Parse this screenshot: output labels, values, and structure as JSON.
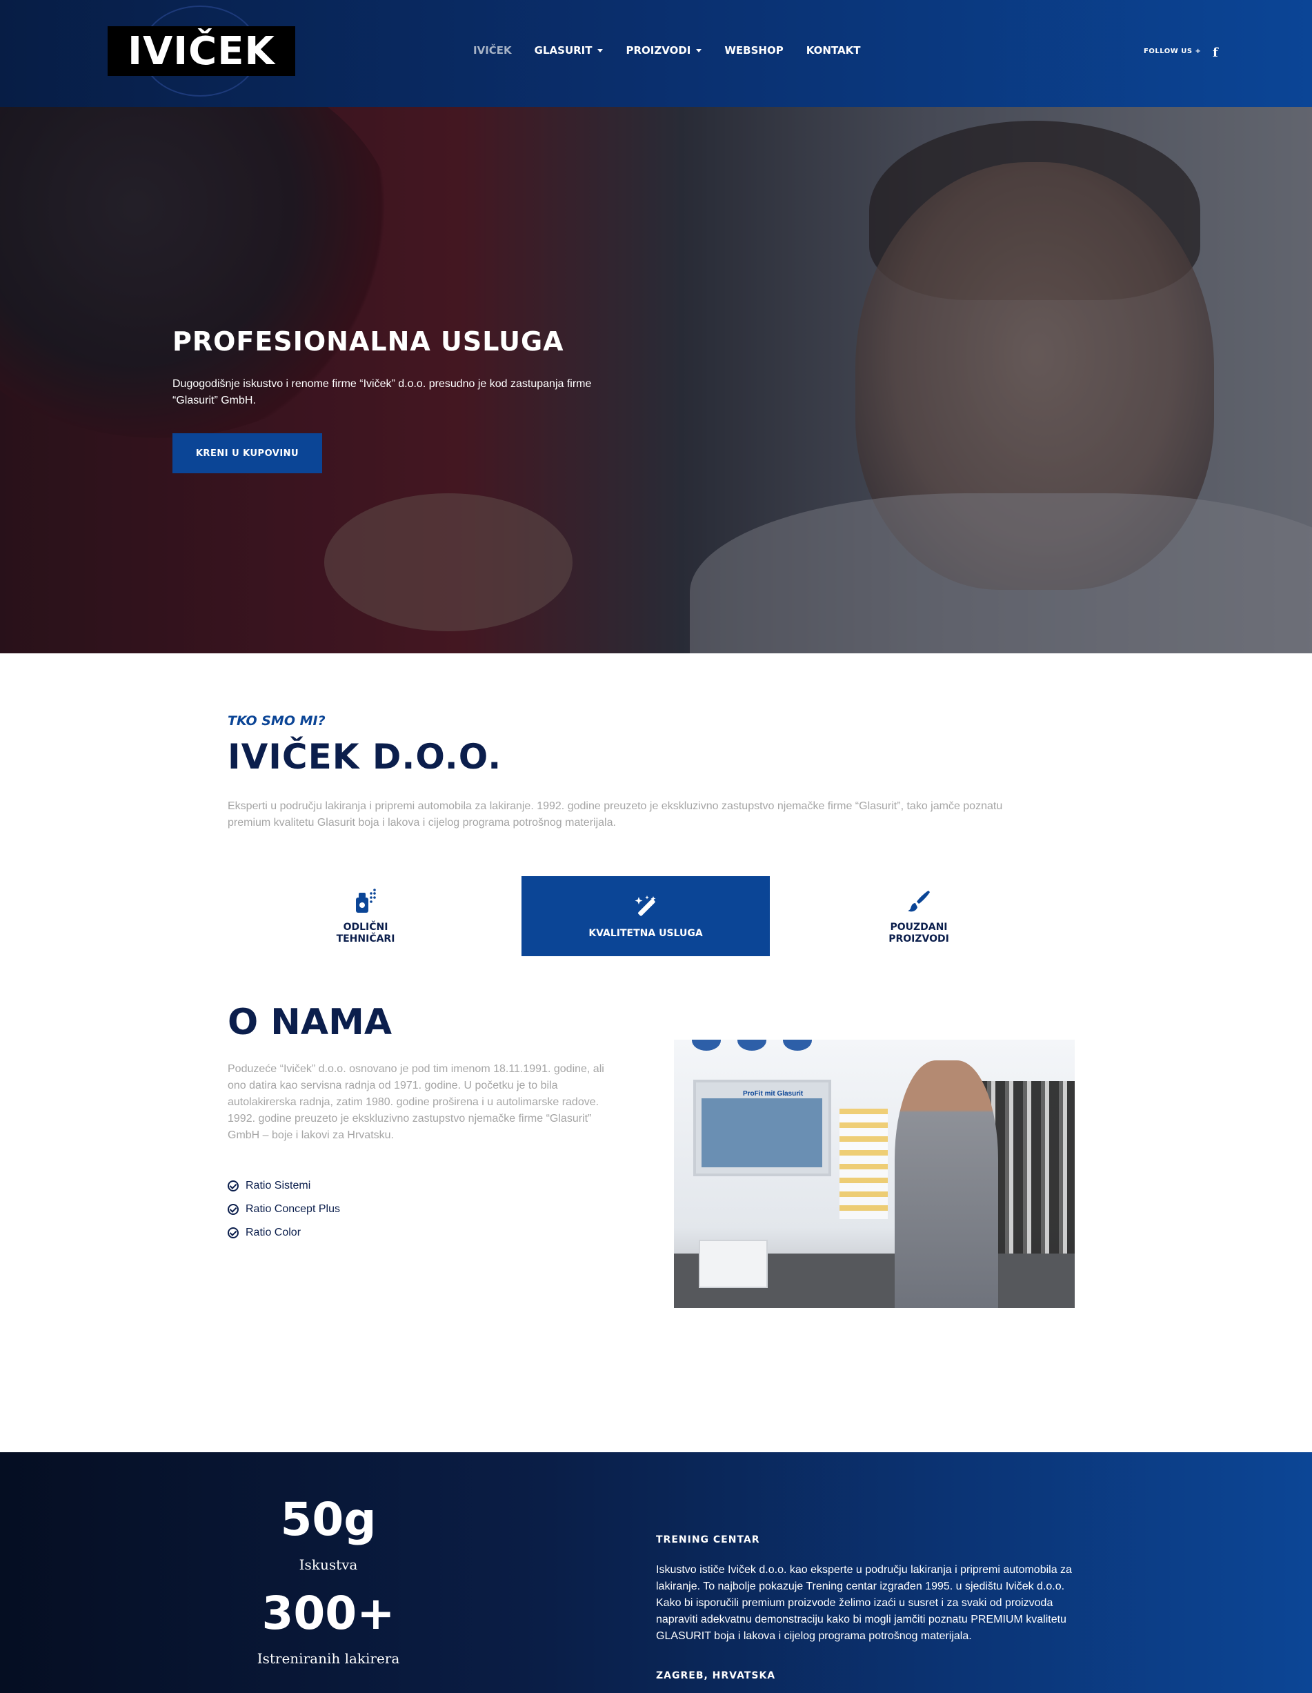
{
  "header": {
    "logo_text": "IVIČEK",
    "nav": [
      {
        "label": "IVIČEK",
        "dropdown": false
      },
      {
        "label": "GLASURIT",
        "dropdown": true
      },
      {
        "label": "PROIZVODI",
        "dropdown": true
      },
      {
        "label": "WEBSHOP",
        "dropdown": false
      },
      {
        "label": "KONTAKT",
        "dropdown": false
      }
    ],
    "follow_label": "FOLLOW US +",
    "social_icon": "f"
  },
  "hero": {
    "title": "PROFESIONALNA USLUGA",
    "text": "Dugogodišnje iskustvo i renome firme “Iviček” d.o.o. presudno je kod zastupanja firme “Glasurit” GmbH.",
    "button_label": "KRENI U KUPOVINU"
  },
  "about": {
    "eyebrow": "TKO SMO MI?",
    "company": "IVIČEK D.O.O.",
    "text": "Eksperti u području lakiranja i pripremi automobila za lakiranje. 1992. godine preuzeto je ekskluzivno zastupstvo njemačke firme “Glasurit”, tako jamče poznatu premium kvalitetu Glasurit boja i lakova i cijelog programa potrošnog materijala."
  },
  "features": [
    {
      "label": "ODLIČNI TEHNIČARI",
      "icon": "spray-can-icon",
      "active": false
    },
    {
      "label": "KVALITETNA USLUGA",
      "icon": "magic-wand-icon",
      "active": true
    },
    {
      "label": "POUZDANI PROIZVODI",
      "icon": "paint-brush-icon",
      "active": false
    }
  ],
  "onama": {
    "title": "O NAMA",
    "text": "Poduzeće “Iviček” d.o.o. osnovano je pod tim imenom 18.11.1991. godine, ali ono datira kao servisna radnja od 1971. godine. U početku je to bila autolakirerska radnja, zatim 1980. godine proširena i u autolimarske radove. 1992. godine preuzeto je ekskluzivno zastupstvo njemačke firme “Glasurit” GmbH – boje i lakovi za Hrvatsku.",
    "checks": [
      "Ratio Sistemi",
      "Ratio Concept Plus",
      "Ratio Color"
    ],
    "photo_label": "ProFit mit Glasurit"
  },
  "stats": {
    "items": [
      {
        "value": "50g",
        "label": "Iskustva"
      },
      {
        "value": "300+",
        "label": "Istreniranih lakirera"
      }
    ],
    "trening_title": "TRENING CENTAR",
    "trening_text": "Iskustvo ističe Iviček d.o.o. kao eksperte u području lakiranja i pripremi automobila za lakiranje. To najbolje pokazuje Trening centar izgrađen 1995. u sjedištu Iviček d.o.o. Kako bi isporučili premium proizvode želimo izaći u susret i za svaki od proizvoda napraviti adekvatnu demonstraciju kako bi mogli jamčiti poznatu PREMIUM kvalitetu GLASURIT boja i lakova i cijelog programa potrošnog materijala.",
    "location": "ZAGREB, HRVATSKA"
  },
  "colors": {
    "brand_blue": "#0b4596",
    "navy": "#0b1e4c",
    "muted_text": "#a5a5a5"
  }
}
